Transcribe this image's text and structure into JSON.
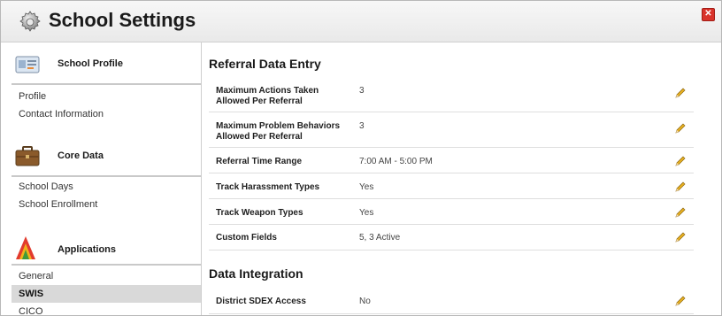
{
  "window": {
    "title": "School Settings",
    "close_label": "✕"
  },
  "sidebar": {
    "sections": [
      {
        "title": "School Profile",
        "icon": "id-card-icon",
        "items": [
          "Profile",
          "Contact Information"
        ]
      },
      {
        "title": "Core Data",
        "icon": "briefcase-icon",
        "items": [
          "School Days",
          "School Enrollment"
        ]
      },
      {
        "title": "Applications",
        "icon": "swis-logo-icon",
        "items": [
          "General",
          "SWIS",
          "CICO"
        ]
      }
    ],
    "active_item": "SWIS"
  },
  "main": {
    "referral": {
      "heading": "Referral Data Entry",
      "rows": [
        {
          "label": "Maximum Actions Taken Allowed Per Referral",
          "value": "3"
        },
        {
          "label": "Maximum Problem Behaviors Allowed Per Referral",
          "value": "3"
        },
        {
          "label": "Referral Time Range",
          "value": "7:00 AM - 5:00 PM"
        },
        {
          "label": "Track Harassment Types",
          "value": "Yes"
        },
        {
          "label": "Track Weapon Types",
          "value": "Yes"
        },
        {
          "label": "Custom Fields",
          "value": "5, 3 Active"
        }
      ]
    },
    "integration": {
      "heading": "Data Integration",
      "rows": [
        {
          "label": "District SDEX Access",
          "value": "No"
        }
      ]
    }
  },
  "colors": {
    "accent_close": "#d9332b",
    "pencil": "#e8b020",
    "active_bg": "#d9d9d9"
  }
}
